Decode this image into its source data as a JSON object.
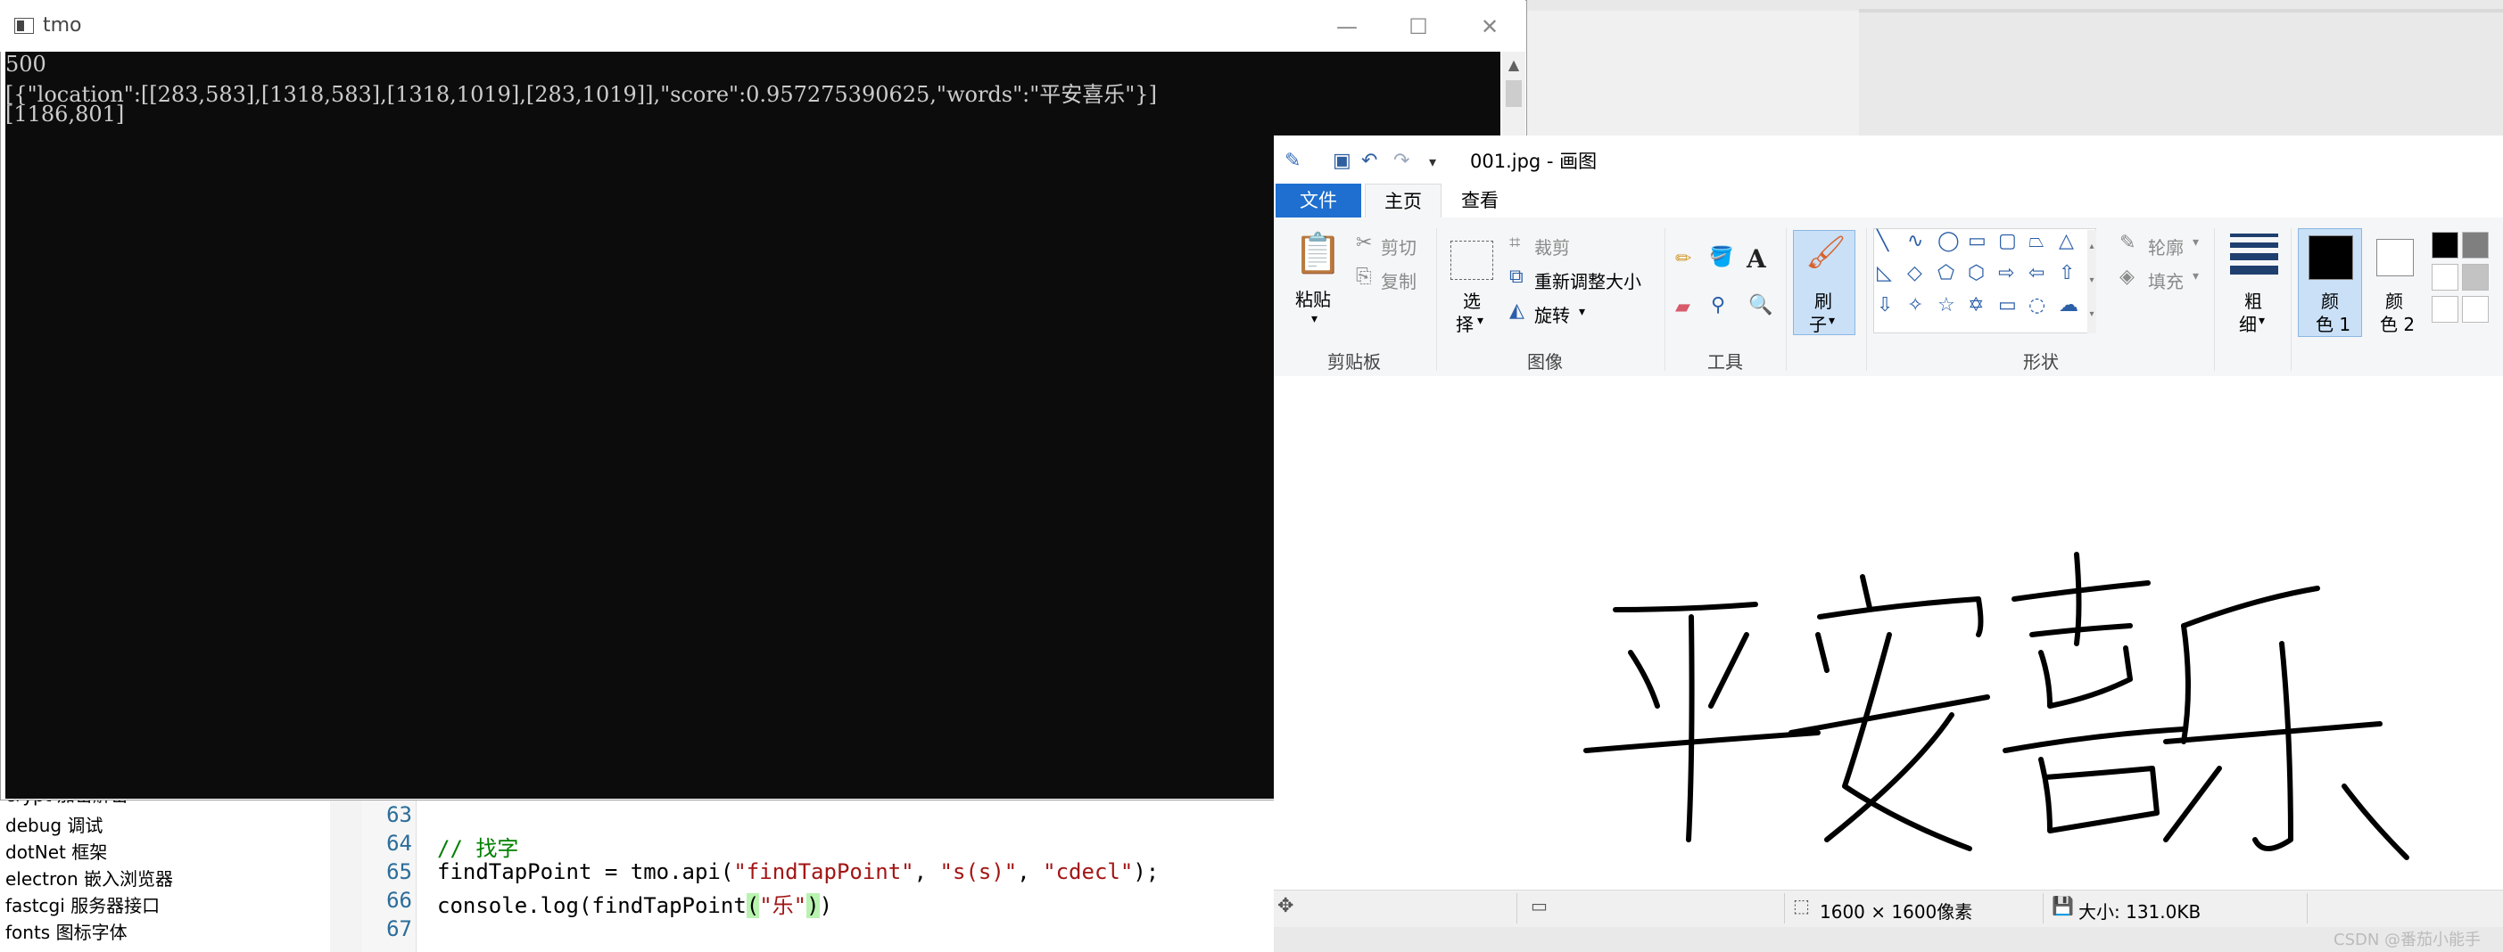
{
  "console": {
    "title": "tmo",
    "lines": [
      "500",
      "[{\"location\":[[283,583],[1318,583],[1318,1019],[283,1019]],\"score\":0.957275390625,\"words\":\"平安喜乐\"}]",
      "[1186,801]"
    ],
    "minimize": "—",
    "maximize": "☐",
    "close": "✕"
  },
  "tree": {
    "items": [
      "crypt 加密解密",
      "debug 调试",
      "dotNet 框架",
      "electron 嵌入浏览器",
      "fastcgi 服务器接口",
      "fonts 图标字体"
    ]
  },
  "code": {
    "line_numbers": [
      "63",
      "64",
      "65",
      "66",
      "67"
    ],
    "line64": "// 找字",
    "line65_a": "findTapPoint = tmo.api(",
    "line65_s1": "\"findTapPoint\"",
    "line65_c1": ", ",
    "line65_s2": "\"s(s)\"",
    "line65_c2": ", ",
    "line65_s3": "\"cdecl\"",
    "line65_end": ");",
    "line66_a": "console.log(findTapPoint",
    "line66_p1": "(",
    "line66_s": "\"乐\"",
    "line66_p2": ")",
    "line66_end": ")"
  },
  "paint": {
    "title": "001.jpg - 画图",
    "tabs": [
      "文件",
      "主页",
      "查看"
    ],
    "clipboard": {
      "paste": "粘贴",
      "cut": "剪切",
      "copy": "复制",
      "label": "剪贴板"
    },
    "image": {
      "select_1": "选",
      "select_2": "择",
      "crop": "裁剪",
      "resize": "重新调整大小",
      "rotate": "旋转",
      "label": "图像"
    },
    "tools": {
      "label": "工具"
    },
    "brush": {
      "l1": "刷",
      "l2": "子"
    },
    "shapes": {
      "outline": "轮廓",
      "fill": "填充",
      "label": "形状"
    },
    "size": {
      "l1": "粗",
      "l2": "细"
    },
    "color1": {
      "l1": "颜",
      "l2": "色 1"
    },
    "color2": {
      "l1": "颜",
      "l2": "色 2"
    },
    "palette": [
      "#000000",
      "#7f7f7f",
      "#ffffff",
      "#c3c3c3"
    ],
    "status": {
      "dimensions": "1600 × 1600像素",
      "size": "大小: 131.0KB"
    },
    "canvas_text": "平安喜乐"
  },
  "watermark": "CSDN @番茄小能手"
}
